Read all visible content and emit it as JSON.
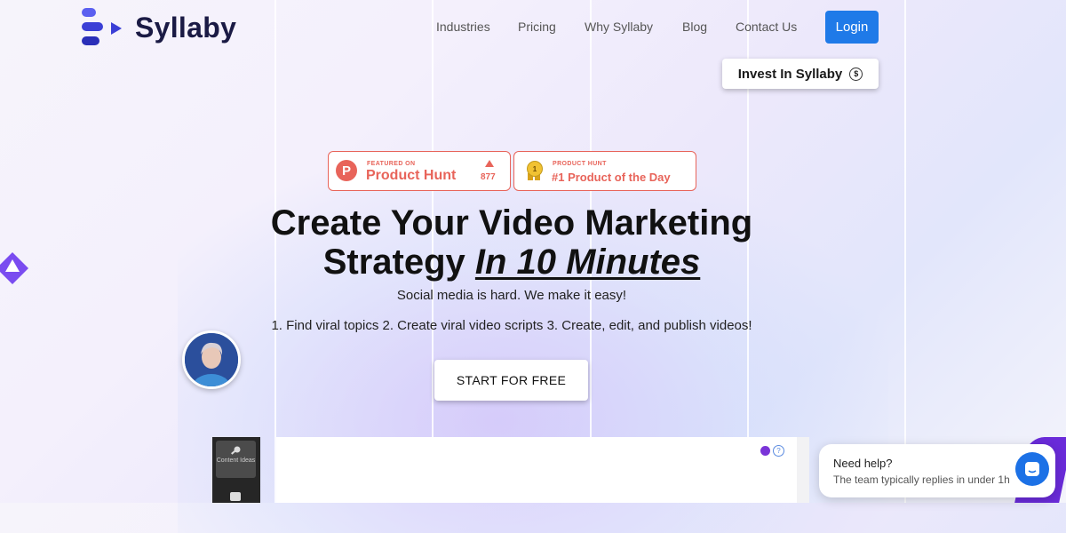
{
  "brand": {
    "name": "Syllaby",
    "colors": {
      "primary": "#1f7ae8",
      "logo": "#3b3fd6",
      "text": "#1a1a44",
      "product_hunt": "#e8645a",
      "accent_purple": "#6a2bd9"
    }
  },
  "nav": {
    "items": [
      "Industries",
      "Pricing",
      "Why Syllaby",
      "Blog",
      "Contact Us"
    ],
    "login_label": "Login",
    "invest_label": "Invest In Syllaby",
    "invest_icon": "$"
  },
  "badges": {
    "featured": {
      "small": "FEATURED ON",
      "big": "Product Hunt",
      "count": "877",
      "icon_letter": "P"
    },
    "award": {
      "small": "PRODUCT HUNT",
      "big": "#1 Product of the Day",
      "medal_number": "1"
    }
  },
  "hero": {
    "title_line1": "Create Your Video Marketing",
    "title_line2_plain": "Strategy ",
    "title_line2_italic": "In 10 Minutes",
    "subtitle": "Social media is hard. We make it easy!",
    "steps": "1. Find viral topics 2. Create viral video scripts 3. Create, edit, and publish videos!",
    "cta_label": "START FOR FREE"
  },
  "app_preview": {
    "sidebar_card_label": "Content Ideas",
    "help_icon": "?"
  },
  "chat": {
    "title": "Need help?",
    "subtitle": "The team typically replies in under 1h"
  }
}
